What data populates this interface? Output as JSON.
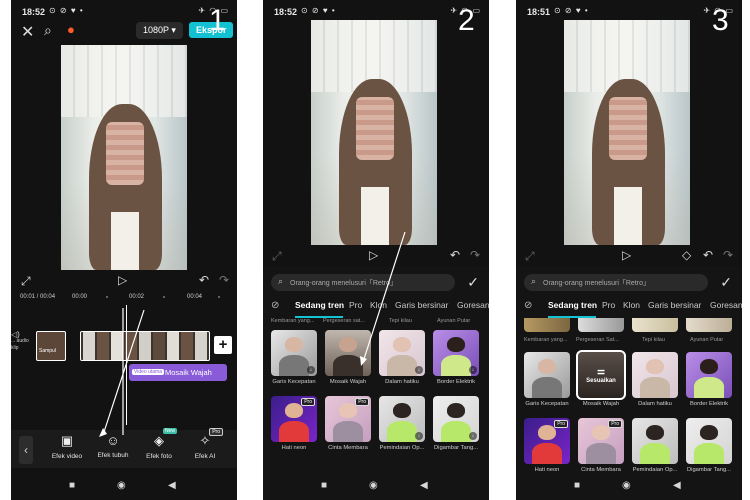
{
  "colors": {
    "accent": "#12c2d2",
    "mosaic_chip": "#8a5bd8",
    "badge_new": "#3fbfa8",
    "phone_bg": "#121212"
  },
  "phone1": {
    "number": "1",
    "status_time": "18:52",
    "resolution": "1080P",
    "export_label": "Ekspor",
    "timeline_marks": [
      "00:01 / 00:04",
      "00:00",
      "00:02",
      "00:04"
    ],
    "mosaic_small": "Video utama",
    "mosaic_label": "Mosaik Wajah",
    "side_label_1": "... audio",
    "side_label_2": "klip",
    "clip_label": "Sampul",
    "tools": [
      {
        "label": "Efek video",
        "icon": "film-icon"
      },
      {
        "label": "Efek tubuh",
        "icon": "face-icon"
      },
      {
        "label": "Efek foto",
        "icon": "cube-icon",
        "badge": "New"
      },
      {
        "label": "Efek AI",
        "icon": "magic-icon",
        "badge": "Pro"
      }
    ]
  },
  "phone2": {
    "number": "2",
    "status_time": "18:52",
    "search_placeholder": "Orang-orang menelusuri「Retro」",
    "categories": [
      "Sedang tren",
      "Pro",
      "Klon",
      "Garis bersinar",
      "Goresan"
    ],
    "toprow": [
      "Kembaran yang...",
      "Pergeseran sat...",
      "Tepi kilau",
      "Ayunan Putar"
    ],
    "effects": [
      {
        "label": "Garis Kecepatan",
        "pro": false
      },
      {
        "label": "Mosaik Wajah",
        "pro": false
      },
      {
        "label": "Dalam hatiku",
        "pro": false
      },
      {
        "label": "Border Elektrik",
        "pro": false
      },
      {
        "label": "Hati neon",
        "pro": true
      },
      {
        "label": "Cinta Membara",
        "pro": true
      },
      {
        "label": "Pemindaian Op...",
        "pro": false
      },
      {
        "label": "Digambar Tang...",
        "pro": false
      }
    ]
  },
  "phone3": {
    "number": "3",
    "status_time": "18:51",
    "search_placeholder": "Orang-orang menelusuri「Retro」",
    "categories": [
      "Sedang tren",
      "Pro",
      "Klon",
      "Garis bersinar",
      "Goresan"
    ],
    "toprow": [
      "Kembaran yang...",
      "Pergeseran Sat...",
      "Tepi kilau",
      "Ayunan Putar"
    ],
    "adjust_label": "Sesuaikan",
    "effects": [
      {
        "label": "Garis Kecepatan",
        "pro": false
      },
      {
        "label": "Mosaik Wajah",
        "pro": false
      },
      {
        "label": "Dalam hatiku",
        "pro": false
      },
      {
        "label": "Border Elektrik",
        "pro": false
      },
      {
        "label": "Hati neon",
        "pro": true
      },
      {
        "label": "Cinta Membara",
        "pro": true
      },
      {
        "label": "Pemindaian Op...",
        "pro": false
      },
      {
        "label": "Digambar Tang...",
        "pro": false
      }
    ]
  }
}
